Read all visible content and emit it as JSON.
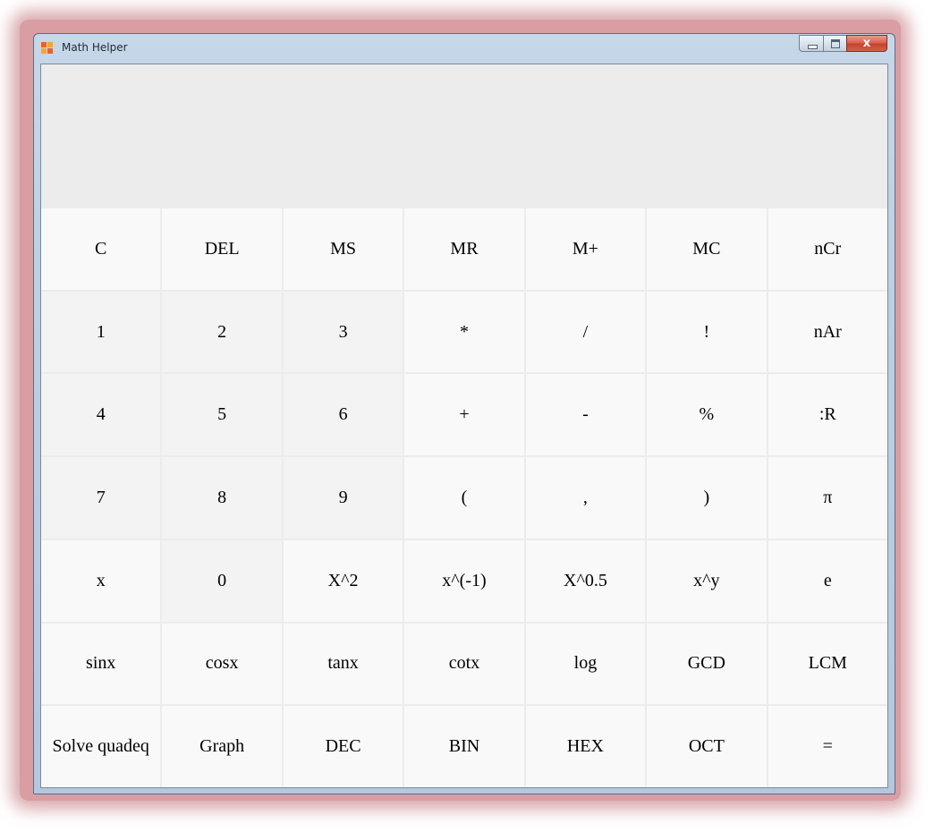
{
  "window": {
    "title": "Math Helper",
    "close_glyph": "x",
    "icon": "app-icon"
  },
  "display": {
    "value": ""
  },
  "keypad": {
    "keys": [
      {
        "label": "C",
        "name": "clear-button",
        "type": "op"
      },
      {
        "label": "DEL",
        "name": "delete-button",
        "type": "op"
      },
      {
        "label": "MS",
        "name": "memory-store-button",
        "type": "op"
      },
      {
        "label": "MR",
        "name": "memory-recall-button",
        "type": "op"
      },
      {
        "label": "M+",
        "name": "memory-add-button",
        "type": "op"
      },
      {
        "label": "MC",
        "name": "memory-clear-button",
        "type": "op"
      },
      {
        "label": "nCr",
        "name": "ncr-button",
        "type": "op"
      },
      {
        "label": "1",
        "name": "digit-1-button",
        "type": "digit"
      },
      {
        "label": "2",
        "name": "digit-2-button",
        "type": "digit"
      },
      {
        "label": "3",
        "name": "digit-3-button",
        "type": "digit"
      },
      {
        "label": "*",
        "name": "multiply-button",
        "type": "op"
      },
      {
        "label": "/",
        "name": "divide-button",
        "type": "op"
      },
      {
        "label": "!",
        "name": "factorial-button",
        "type": "op"
      },
      {
        "label": "nAr",
        "name": "nar-button",
        "type": "op"
      },
      {
        "label": "4",
        "name": "digit-4-button",
        "type": "digit"
      },
      {
        "label": "5",
        "name": "digit-5-button",
        "type": "digit"
      },
      {
        "label": "6",
        "name": "digit-6-button",
        "type": "digit"
      },
      {
        "label": "+",
        "name": "plus-button",
        "type": "op"
      },
      {
        "label": "-",
        "name": "minus-button",
        "type": "op"
      },
      {
        "label": "%",
        "name": "percent-button",
        "type": "op"
      },
      {
        "label": ":R",
        "name": "remainder-button",
        "type": "op"
      },
      {
        "label": "7",
        "name": "digit-7-button",
        "type": "digit"
      },
      {
        "label": "8",
        "name": "digit-8-button",
        "type": "digit"
      },
      {
        "label": "9",
        "name": "digit-9-button",
        "type": "digit"
      },
      {
        "label": "(",
        "name": "open-paren-button",
        "type": "op"
      },
      {
        "label": ",",
        "name": "comma-button",
        "type": "op"
      },
      {
        "label": ")",
        "name": "close-paren-button",
        "type": "op"
      },
      {
        "label": "π",
        "name": "pi-button",
        "type": "op"
      },
      {
        "label": "x",
        "name": "x-variable-button",
        "type": "op"
      },
      {
        "label": "0",
        "name": "digit-0-button",
        "type": "digit"
      },
      {
        "label": "X^2",
        "name": "square-button",
        "type": "op"
      },
      {
        "label": "x^(-1)",
        "name": "reciprocal-button",
        "type": "op"
      },
      {
        "label": "X^0.5",
        "name": "square-root-button",
        "type": "op"
      },
      {
        "label": "x^y",
        "name": "power-button",
        "type": "op"
      },
      {
        "label": "e",
        "name": "euler-button",
        "type": "op"
      },
      {
        "label": "sinx",
        "name": "sin-button",
        "type": "op"
      },
      {
        "label": "cosx",
        "name": "cos-button",
        "type": "op"
      },
      {
        "label": "tanx",
        "name": "tan-button",
        "type": "op"
      },
      {
        "label": "cotx",
        "name": "cot-button",
        "type": "op"
      },
      {
        "label": "log",
        "name": "log-button",
        "type": "op"
      },
      {
        "label": "GCD",
        "name": "gcd-button",
        "type": "op"
      },
      {
        "label": "LCM",
        "name": "lcm-button",
        "type": "op"
      },
      {
        "label": "Solve quadeq",
        "name": "solve-quadeq-button",
        "type": "op"
      },
      {
        "label": "Graph",
        "name": "graph-button",
        "type": "op"
      },
      {
        "label": "DEC",
        "name": "dec-button",
        "type": "op"
      },
      {
        "label": "BIN",
        "name": "bin-button",
        "type": "op"
      },
      {
        "label": "HEX",
        "name": "hex-button",
        "type": "op"
      },
      {
        "label": "OCT",
        "name": "oct-button",
        "type": "op"
      },
      {
        "label": "=",
        "name": "equals-button",
        "type": "op"
      }
    ]
  },
  "colors": {
    "display_bg": "#ececec",
    "key_bg": "#f9f9f9",
    "digit_key_bg": "#f3f3f3",
    "window_frame": "#bcd0e3",
    "glow": "#d89ea3",
    "close_button": "#c7432d"
  }
}
